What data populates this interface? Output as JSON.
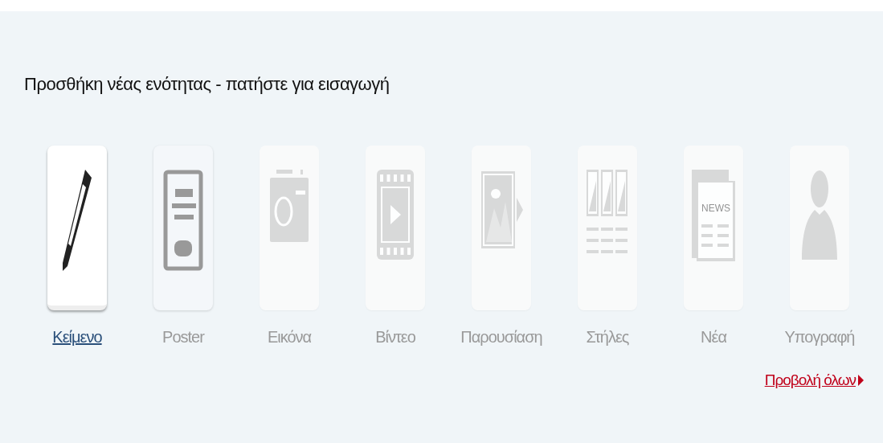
{
  "heading": "Προσθήκη νέας ενότητας - πατήστε για εισαγωγή",
  "items": [
    {
      "kind": "text",
      "label": "Κείμενο",
      "selected": true,
      "hovered": false
    },
    {
      "kind": "poster",
      "label": "Poster",
      "selected": false,
      "hovered": true
    },
    {
      "kind": "image",
      "label": "Εικόνα",
      "selected": false,
      "hovered": false
    },
    {
      "kind": "video",
      "label": "Βίντεο",
      "selected": false,
      "hovered": false
    },
    {
      "kind": "slideshow",
      "label": "Παρουσίαση",
      "selected": false,
      "hovered": false
    },
    {
      "kind": "columns",
      "label": "Στήλες",
      "selected": false,
      "hovered": false
    },
    {
      "kind": "news",
      "label": "Νέα",
      "icon_text": "NEWS",
      "selected": false,
      "hovered": false
    },
    {
      "kind": "signature",
      "label": "Υπογραφή",
      "selected": false,
      "hovered": false
    }
  ],
  "view_all": {
    "label": "Προβολή όλων"
  }
}
